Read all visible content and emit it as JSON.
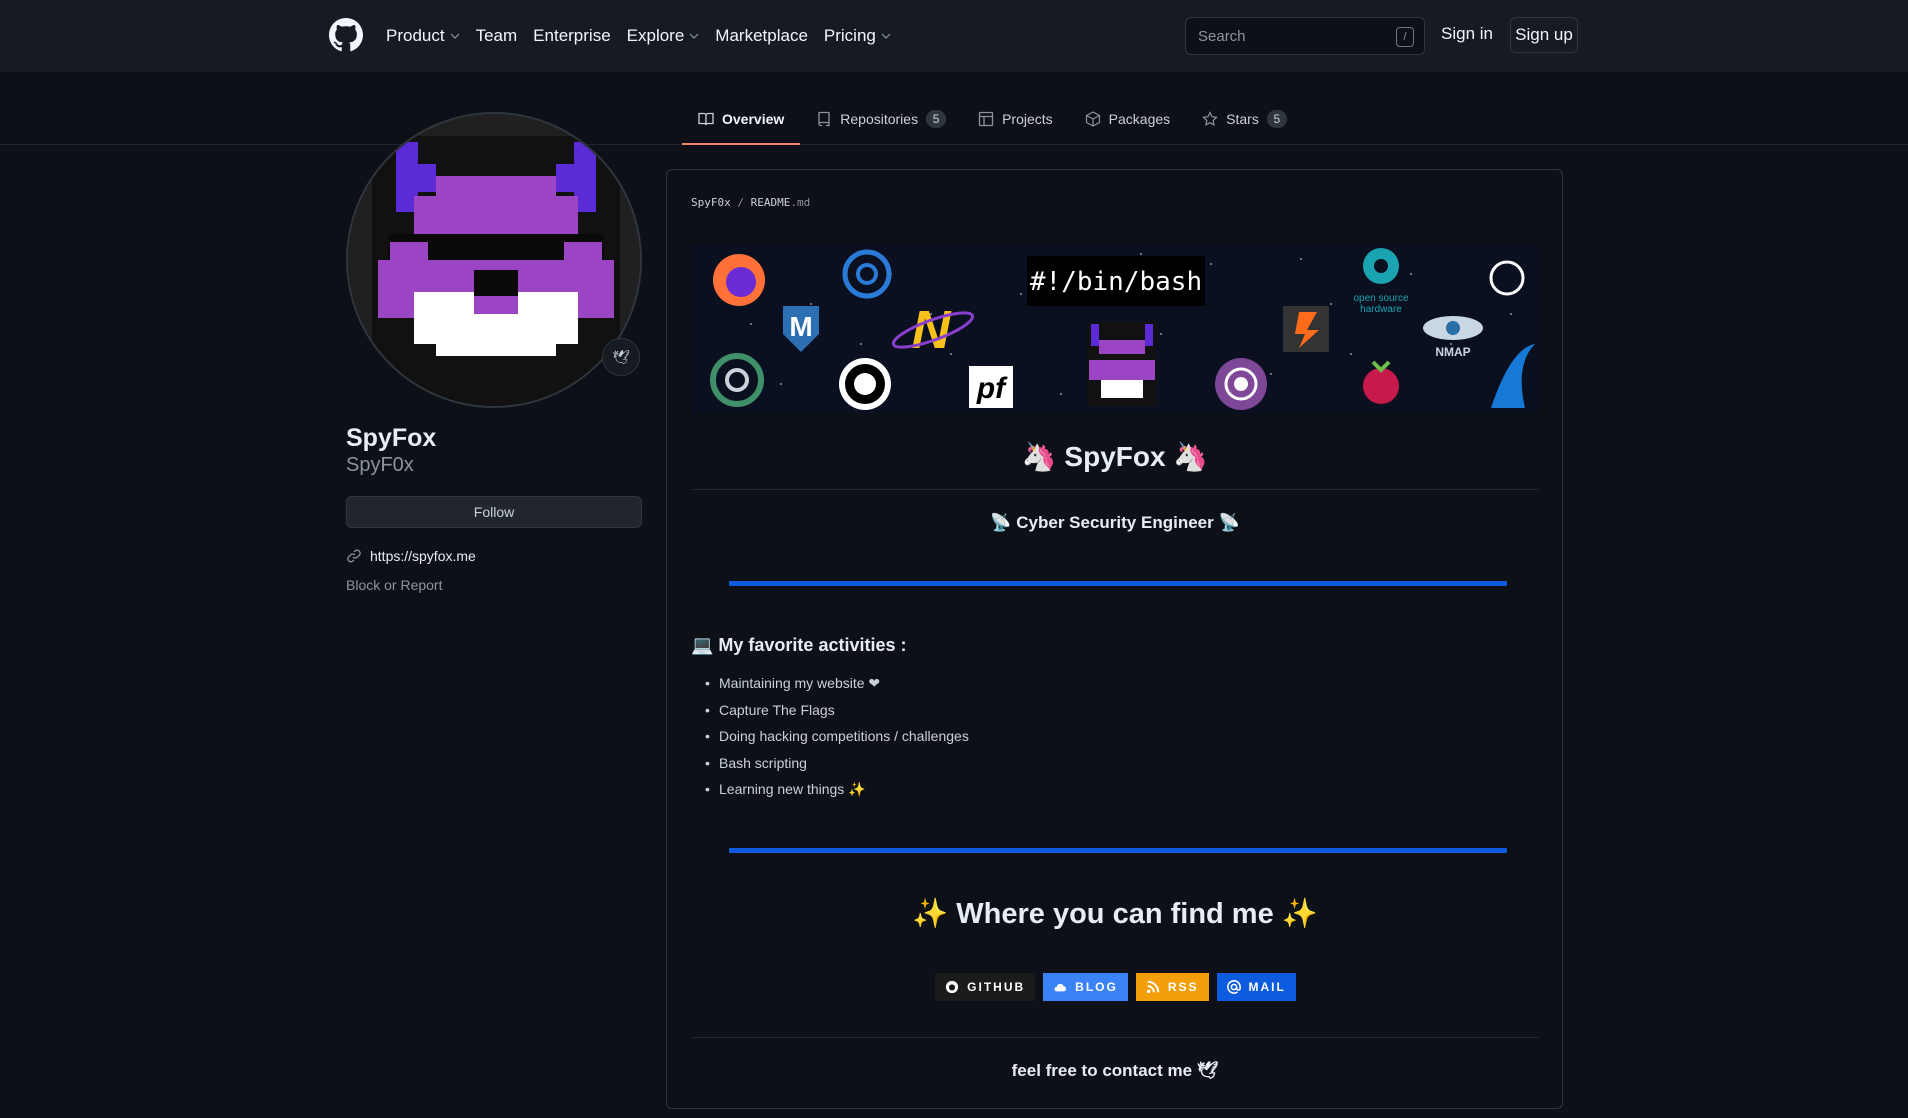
{
  "header": {
    "nav": [
      {
        "label": "Product",
        "dropdown": true
      },
      {
        "label": "Team",
        "dropdown": false
      },
      {
        "label": "Enterprise",
        "dropdown": false
      },
      {
        "label": "Explore",
        "dropdown": true
      },
      {
        "label": "Marketplace",
        "dropdown": false
      },
      {
        "label": "Pricing",
        "dropdown": true
      }
    ],
    "search_placeholder": "Search",
    "search_shortcut": "/",
    "signin": "Sign in",
    "signup": "Sign up"
  },
  "tabs": [
    {
      "label": "Overview",
      "icon": "book-icon",
      "active": true
    },
    {
      "label": "Repositories",
      "icon": "repo-icon",
      "count": "5"
    },
    {
      "label": "Projects",
      "icon": "table-icon"
    },
    {
      "label": "Packages",
      "icon": "package-icon"
    },
    {
      "label": "Stars",
      "icon": "star-icon",
      "count": "5"
    }
  ],
  "profile": {
    "fullname": "SpyFox",
    "username": "SpyF0x",
    "status_emoji": "🕊",
    "follow": "Follow",
    "website": "https://spyfox.me",
    "block": "Block or Report"
  },
  "readme": {
    "owner": "SpyF0x",
    "sep": "/",
    "file": "README",
    "ext": ".md",
    "banner_text": "#!/bin/bash",
    "title": "🦄 SpyFox 🦄",
    "subtitle": "📡 Cyber Security Engineer 📡",
    "activities_title": "💻 My favorite activities :",
    "activities": [
      "Maintaining my website ❤",
      "Capture The Flags",
      "Doing hacking competitions / challenges",
      "Bash scripting",
      "Learning new things ✨"
    ],
    "find_me": "✨ Where you can find me ✨",
    "badges": [
      {
        "label": "GITHUB",
        "color": "#1b1b1b",
        "icon": "github-icon"
      },
      {
        "label": "BLOG",
        "color": "#3b82f6",
        "icon": "cloud-icon"
      },
      {
        "label": "RSS",
        "color": "#f59e0b",
        "icon": "rss-icon"
      },
      {
        "label": "MAIL",
        "color": "#0d5ce0",
        "icon": "at-icon"
      }
    ],
    "contact": "feel free to contact me 🕊",
    "accent_line": "#0d5ce0"
  },
  "colors": {
    "bg": "#0d1117",
    "header": "#161b22",
    "tab_underline": "#f78166"
  }
}
